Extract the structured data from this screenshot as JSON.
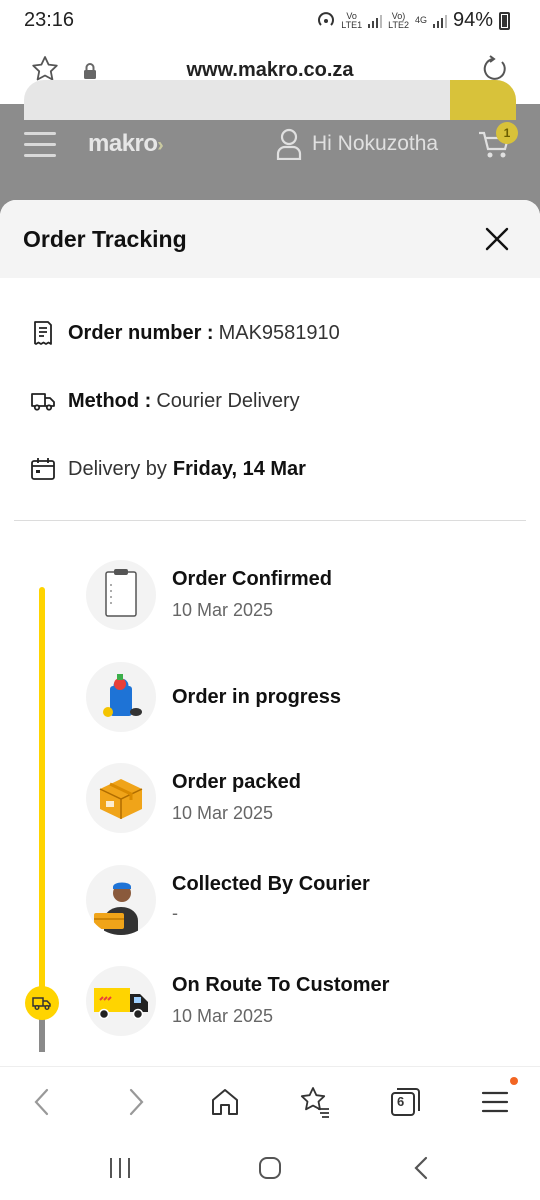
{
  "status_bar": {
    "time": "23:16",
    "sim1": "Vo\nLTE1",
    "sim2": "Vo)\nLTE2",
    "net2": "4G",
    "battery": "94%"
  },
  "browser": {
    "url": "www.makro.co.za"
  },
  "site_header": {
    "logo": "makro",
    "greeting": "Hi Nokuzotha",
    "cart_count": "1",
    "accent_color": "#ffd400"
  },
  "sheet": {
    "title": "Order Tracking",
    "order_number_label": "Order number :",
    "order_number_value": "MAK9581910",
    "method_label": "Method :",
    "method_value": "Courier Delivery",
    "delivery_prefix": "Delivery by",
    "delivery_date": "Friday, 14 Mar"
  },
  "steps": [
    {
      "title": "Order Confirmed",
      "date": "10 Mar 2025",
      "icon": "clipboard-icon"
    },
    {
      "title": "Order in progress",
      "date": "",
      "icon": "shopping-bag-icon"
    },
    {
      "title": "Order packed",
      "date": "10 Mar 2025",
      "icon": "package-box-icon"
    },
    {
      "title": "Collected By Courier",
      "date": "-",
      "icon": "courier-person-icon"
    },
    {
      "title": "On Route To Customer",
      "date": "10 Mar 2025",
      "icon": "delivery-truck-icon"
    }
  ],
  "browser_toolbar": {
    "tabs_count": "6"
  }
}
